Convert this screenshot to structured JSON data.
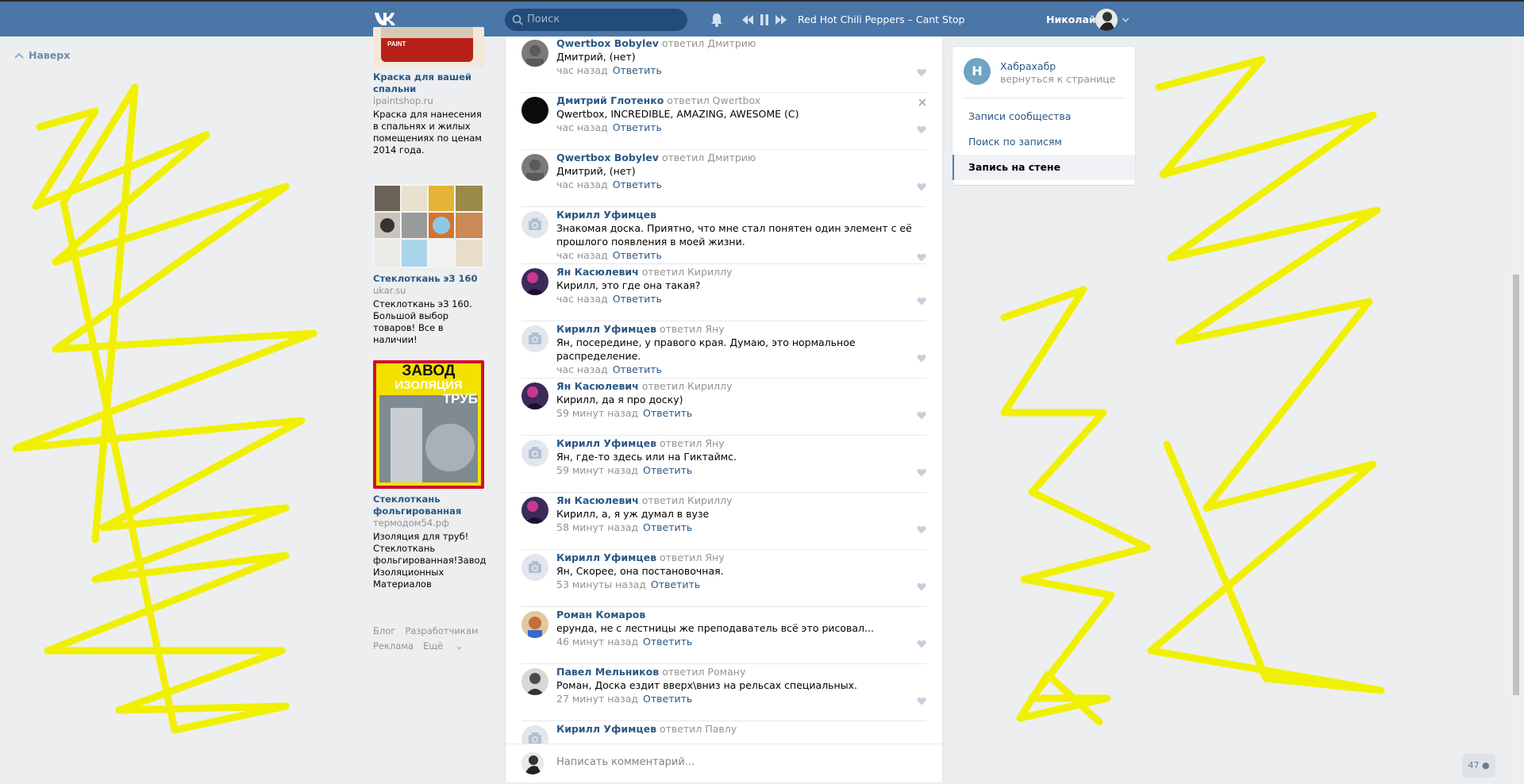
{
  "header": {
    "search_placeholder": "Поиск",
    "track": "Red Hot Chili Peppers – Cant Stop",
    "user_name": "Николай"
  },
  "up_link": "Наверх",
  "ads": [
    {
      "title": "Краска для вашей спальни",
      "domain": "ipaintshop.ru",
      "text": "Краска для нанесения в спальнях и жилых помещениях по ценам 2014 года."
    },
    {
      "title": "Стеклоткань эЗ 160",
      "domain": "ukar.su",
      "text": "Стеклоткань эЗ 160. Большой выбор товаров! Все в наличии!"
    },
    {
      "title": "Стеклоткань фольгированная",
      "domain": "термодом54.рф",
      "text": "Изоляция для труб! Стеклоткань фольгированная!Завод Изоляционных Материалов",
      "img_line1": "ЗАВОД",
      "img_line2": "ИЗОЛЯЦИЯ",
      "img_line3": "ТРУБ"
    }
  ],
  "ad_footer": {
    "blog": "Блог",
    "devs": "Разработчикам",
    "ads": "Реклама",
    "more": "Ещё"
  },
  "comments": [
    {
      "author": "Qwertbox Bobylev",
      "reply_to": "ответил Дмитрию",
      "text": "Дмитрий, (нет)",
      "time": "час назад"
    },
    {
      "author": "Дмитрий Глотенко",
      "reply_to": "ответил Qwertbox",
      "text": "Qwertbox, INCREDIBLE, AMAZING, AWESOME (C)",
      "time": "час назад"
    },
    {
      "author": "Qwertbox Bobylev",
      "reply_to": "ответил Дмитрию",
      "text": "Дмитрий, (нет)",
      "time": "час назад"
    },
    {
      "author": "Кирилл Уфимцев",
      "reply_to": "",
      "text": "Знакомая доска. Приятно, что мне стал понятен один элемент с её прошлого появления в моей жизни.",
      "time": "час назад"
    },
    {
      "author": "Ян Касюлевич",
      "reply_to": "ответил Кириллу",
      "text": "Кирилл, это где она такая?",
      "time": "час назад"
    },
    {
      "author": "Кирилл Уфимцев",
      "reply_to": "ответил Яну",
      "text": "Ян, посередине, у правого края. Думаю, это нормальное распределение.",
      "time": "час назад"
    },
    {
      "author": "Ян Касюлевич",
      "reply_to": "ответил Кириллу",
      "text": "Кирилл, да я про доску)",
      "time": "59 минут назад"
    },
    {
      "author": "Кирилл Уфимцев",
      "reply_to": "ответил Яну",
      "text": "Ян, где-то здесь или на Гиктаймс.",
      "time": "59 минут назад"
    },
    {
      "author": "Ян Касюлевич",
      "reply_to": "ответил Кириллу",
      "text": "Кирилл, а, я уж думал в вузе",
      "time": "58 минут назад"
    },
    {
      "author": "Кирилл Уфимцев",
      "reply_to": "ответил Яну",
      "text": "Ян, Скорее, она постановочная.",
      "time": "53 минуты назад"
    },
    {
      "author": "Роман Комаров",
      "reply_to": "",
      "text": "ерунда, не с лестницы же преподаватель всё это рисовал...",
      "time": "46 минут назад"
    },
    {
      "author": "Павел Мельников",
      "reply_to": "ответил Роману",
      "text": "Роман, Доска ездит вверх\\вниз на рельсах специальных.",
      "time": "27 минут назад"
    },
    {
      "author": "Кирилл Уфимцев",
      "reply_to": "ответил Павлу",
      "text": "",
      "time": ""
    }
  ],
  "reply_label": "Ответить",
  "compose_placeholder": "Написать комментарий...",
  "side": {
    "group_initial": "Н",
    "group_name": "Хабрахабр",
    "group_back": "вернуться к странице",
    "items": [
      "Записи сообщества",
      "Поиск по записям",
      "Запись на стене"
    ]
  },
  "counter": "47",
  "colors": {
    "header": "#4a76a8",
    "link": "#2a5885",
    "scribble": "#f0f000"
  }
}
